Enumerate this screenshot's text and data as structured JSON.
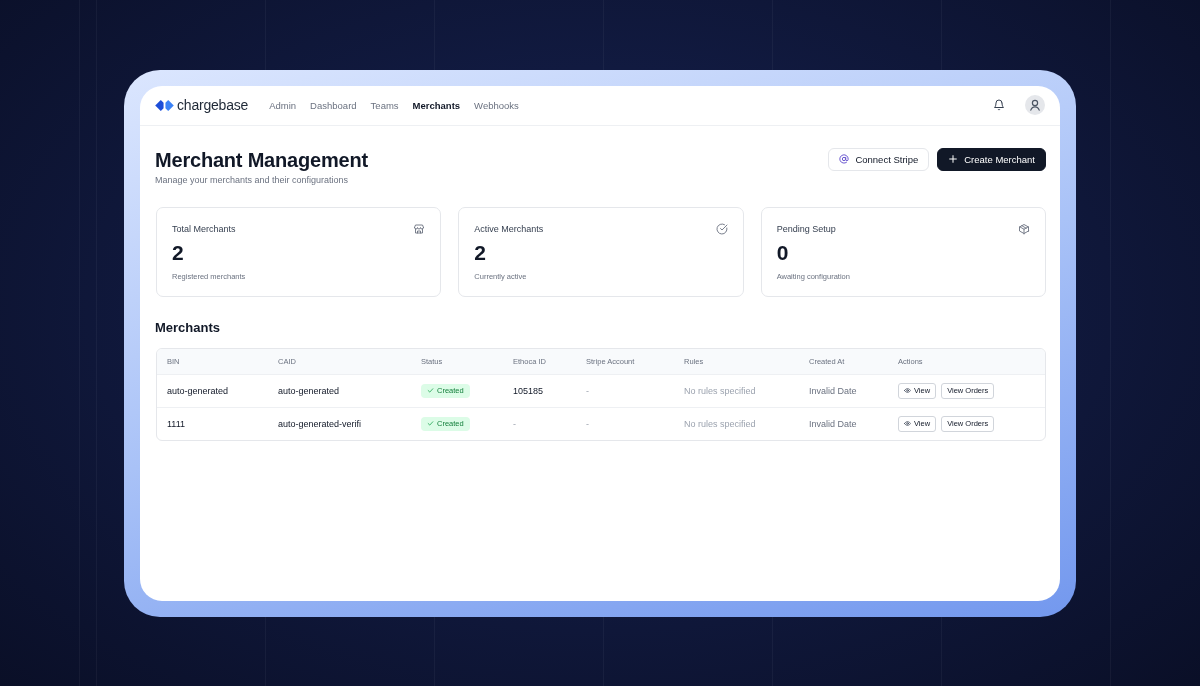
{
  "nav_bar": {
    "logo": "chargebase",
    "links": [
      {
        "label": "Admin",
        "selected": false
      },
      {
        "label": "Dashboard",
        "selected": false
      },
      {
        "label": "Teams",
        "selected": false
      },
      {
        "label": "Merchants",
        "selected": true
      },
      {
        "label": "Webhooks",
        "selected": false
      }
    ]
  },
  "page_header": {
    "title": "Merchant Management",
    "subtitle": "Manage your merchants and their configurations",
    "buttons": [
      {
        "label": "Connect Stripe",
        "kind": "secondary"
      },
      {
        "label": "Create Merchant",
        "kind": "primary"
      }
    ]
  },
  "stats": [
    {
      "label": "Total Merchants",
      "value": "2",
      "caption": "Registered merchants"
    },
    {
      "label": "Active Merchants",
      "value": "2",
      "caption": "Currently active"
    },
    {
      "label": "Pending Setup",
      "value": "0",
      "caption": "Awaiting configuration"
    }
  ],
  "merchants": {
    "title": "Merchants",
    "columns": [
      "BIN",
      "CAID",
      "Status",
      "Ethoca ID",
      "Stripe Account",
      "Rules",
      "Created At",
      "Actions"
    ],
    "rows": [
      {
        "bin": "auto-generated",
        "caid": "auto-generated",
        "status": {
          "label": "Created",
          "kind": "success"
        },
        "ethoca_id": "105185",
        "stripe_account": "-",
        "rules": "No rules specified",
        "created_at": "Invalid Date",
        "actions": [
          {
            "label": "View",
            "kind": "view"
          },
          {
            "label": "View Orders",
            "kind": "orders"
          }
        ]
      },
      {
        "bin": "1111",
        "caid": "auto-generated-verifi",
        "status": {
          "label": "Created",
          "kind": "success"
        },
        "ethoca_id": "-",
        "stripe_account": "-",
        "rules": "No rules specified",
        "created_at": "Invalid Date",
        "actions": [
          {
            "label": "View",
            "kind": "view"
          },
          {
            "label": "View Orders",
            "kind": "orders"
          }
        ]
      }
    ]
  }
}
